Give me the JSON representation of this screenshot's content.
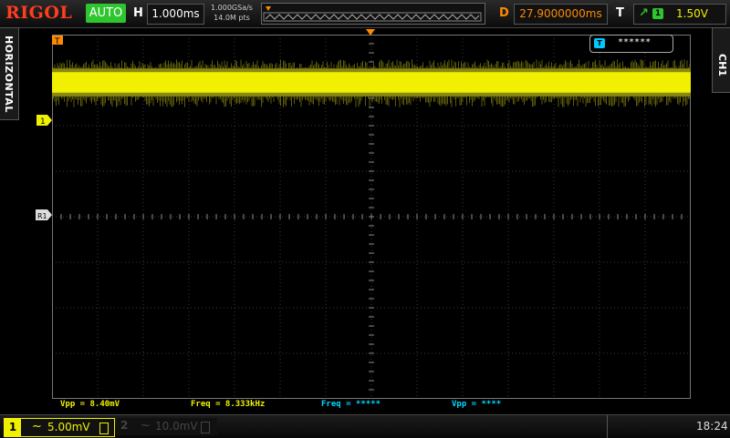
{
  "brand": "RIGOL",
  "run_mode": "AUTO",
  "horizontal": {
    "label": "H",
    "timebase": "1.000ms",
    "sample_rate": "1.000GSa/s",
    "memory_depth": "14.0M pts",
    "delay_label": "D",
    "delay": "27.9000000ms",
    "tab": "HORIZONTAL"
  },
  "trigger": {
    "label": "T",
    "source_badge": "1",
    "level": "1.50V",
    "color": "#2ec62e"
  },
  "channel_tab": "CH1",
  "notice_box": {
    "text": "******"
  },
  "markers": {
    "ch1": "1",
    "ref": "R1",
    "trigger_pos": "T"
  },
  "measurements": [
    {
      "text": "Vpp = 8.40mV",
      "color": "#f0f000"
    },
    {
      "text": "Freq = 8.333kHz",
      "color": "#f0f000"
    },
    {
      "text": "Freq = *****",
      "color": "#00d8ff"
    },
    {
      "text": "Vpp = ****",
      "color": "#00d8ff"
    }
  ],
  "channels": [
    {
      "num": "1",
      "coupling": "~",
      "scale": "5.00mV",
      "color": "#f0f000",
      "enabled": true
    },
    {
      "num": "2",
      "coupling": "~",
      "scale": "10.0mV",
      "color": "#444444",
      "enabled": false
    }
  ],
  "clock": "18:24",
  "trace": {
    "level_div": 1.05,
    "band_div": 0.45,
    "color": "#f0f000"
  }
}
